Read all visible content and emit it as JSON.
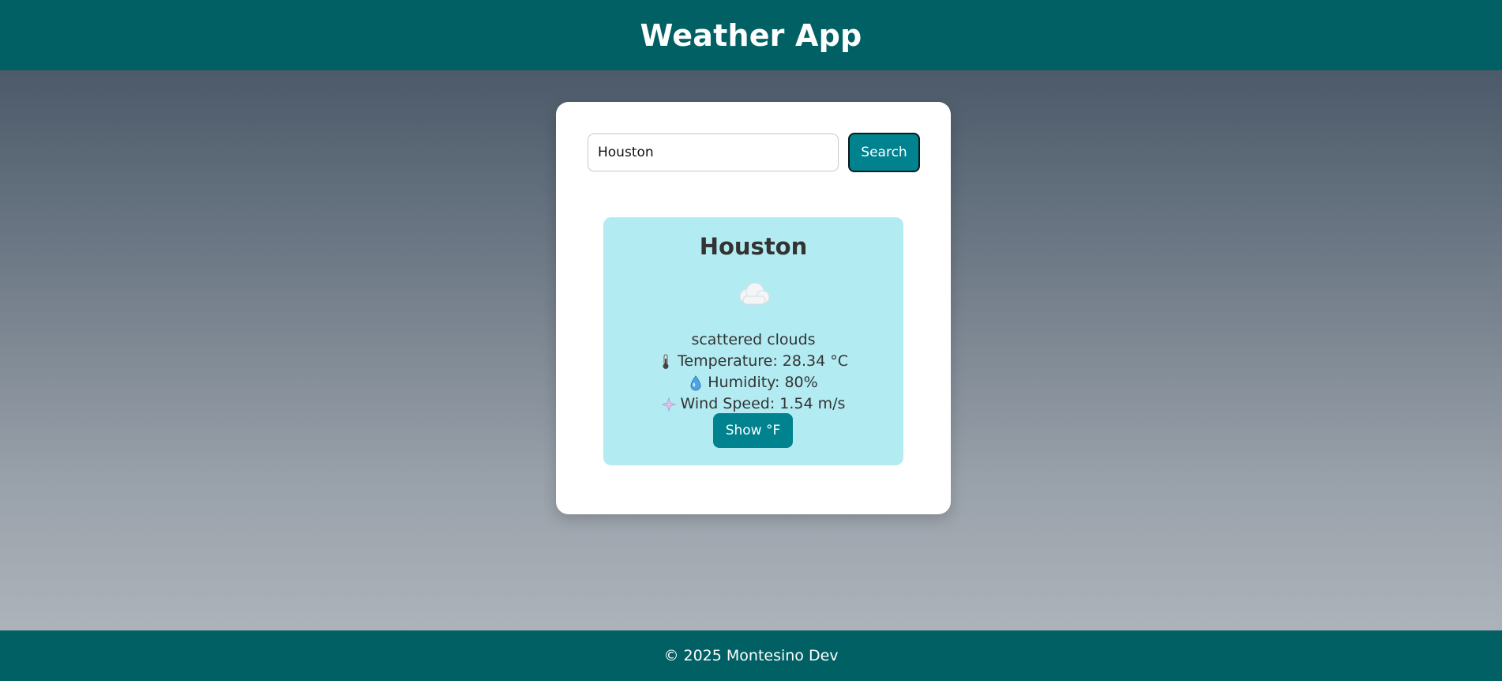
{
  "header": {
    "title": "Weather App"
  },
  "search": {
    "value": "Houston",
    "button_label": "Search"
  },
  "weather": {
    "city": "Houston",
    "icon": "cloud-icon",
    "description": "scattered clouds",
    "temperature": "Temperature: 28.34 °C",
    "humidity": "Humidity: 80%",
    "wind": "Wind Speed: 1.54 m/s",
    "toggle_label": "Show °F"
  },
  "footer": {
    "text": "© 2025 Montesino Dev"
  },
  "colors": {
    "header_bg": "#006064",
    "button_bg": "#00838f",
    "card_bg": "#b2ebf2",
    "text": "#333333"
  }
}
